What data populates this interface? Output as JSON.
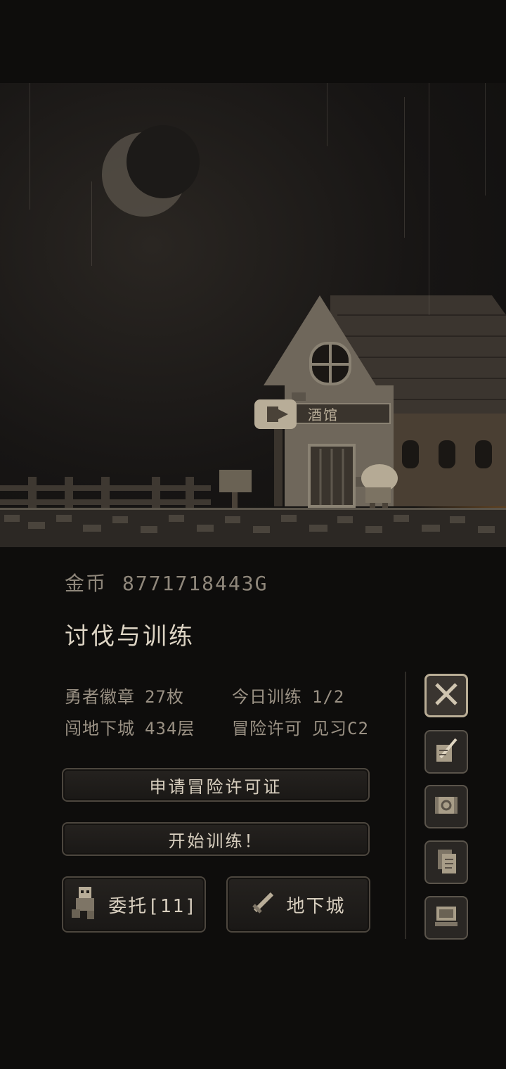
{
  "scene": {
    "sign_text": "酒馆"
  },
  "gold": {
    "label": "金币",
    "value": "8771718443G"
  },
  "section": {
    "title": "讨伐与训练"
  },
  "stats": {
    "badge_label": "勇者徽章",
    "badge_value": "27枚",
    "training_label": "今日训练",
    "training_value": "1/2",
    "dungeon_label": "闯地下城",
    "dungeon_value": "434层",
    "license_label": "冒险许可",
    "license_value": "见习C2"
  },
  "buttons": {
    "apply_license": "申请冒险许可证",
    "start_training": "开始训练！",
    "commission": "委托[11]",
    "dungeon": "地下城"
  },
  "side_menu": [
    {
      "icon": "crossed-swords-icon",
      "active": true
    },
    {
      "icon": "quill-paper-icon",
      "active": false
    },
    {
      "icon": "map-scroll-icon",
      "active": false
    },
    {
      "icon": "documents-icon",
      "active": false
    },
    {
      "icon": "computer-icon",
      "active": false
    }
  ],
  "colors": {
    "background": "#0e0d0c",
    "text": "#d8cfbf",
    "muted": "#9a9184",
    "tavern_light": "#6a4a28"
  }
}
